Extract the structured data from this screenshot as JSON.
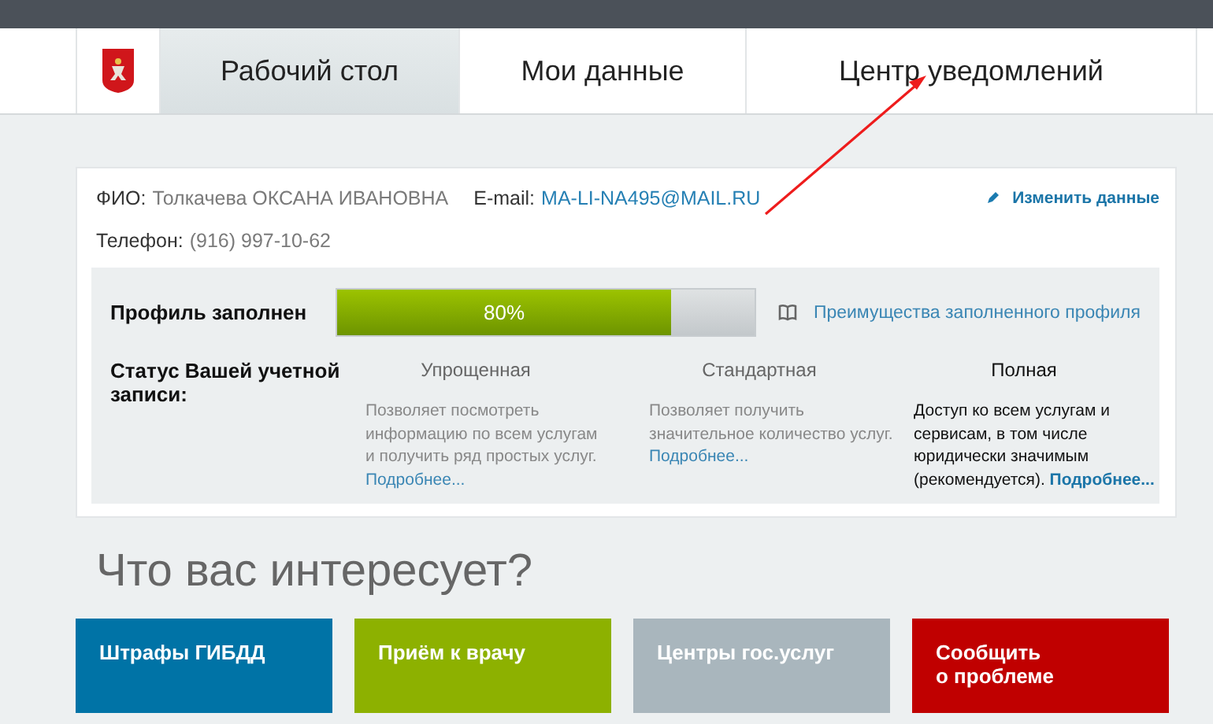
{
  "nav": {
    "tabs": [
      {
        "label": "Рабочий стол",
        "selected": true
      },
      {
        "label": "Мои данные",
        "selected": false
      },
      {
        "label": "Центр уведомлений",
        "selected": false
      }
    ]
  },
  "profile": {
    "fio_label": "ФИО:",
    "fio": "Толкачева ОКСАНА ИВАНОВНА",
    "email_label": "E-mail:",
    "email": "MA-LI-NA495@MAIL.RU",
    "phone_label": "Телефон:",
    "phone": "(916) 997-10-62",
    "edit_link": "Изменить данные"
  },
  "completion": {
    "label": "Профиль заполнен",
    "level": 0.8,
    "reading": "80%",
    "benefits_link": "Преимущества заполненного профиля"
  },
  "status": {
    "label": "Статус Вашей учетной записи:",
    "levels": [
      {
        "name": "Упрощенная",
        "description": "Позволяет посмотреть информацию по всем услугам и получить ряд простых услуг.",
        "more": "Подробнее...",
        "selected": false
      },
      {
        "name": "Стандартная",
        "description": "Позволяет получить значительное количество услуг.",
        "more": "Подробнее...",
        "selected": false
      },
      {
        "name": "Полная",
        "description": "Доступ ко всем услугам и сервисам, в том числе юридически значимым (рекомендуется).",
        "more": "Подробнее...",
        "selected": true
      }
    ]
  },
  "interests": {
    "title": "Что вас интересует?",
    "tiles": [
      {
        "title": "Штрафы ГИБДД",
        "color": "#0073a6"
      },
      {
        "title": "Приём к врачу",
        "color": "#8db100"
      },
      {
        "title": "Центры гос.услуг",
        "color": "#a9b6bd"
      },
      {
        "title": "Сообщить\nо проблеме",
        "color": "#c00000"
      }
    ]
  }
}
